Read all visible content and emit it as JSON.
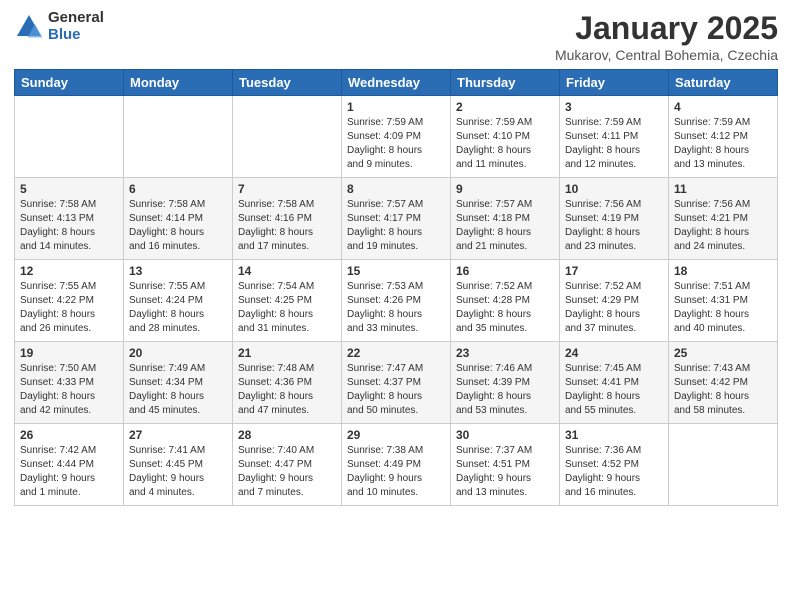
{
  "logo": {
    "general": "General",
    "blue": "Blue"
  },
  "title": "January 2025",
  "location": "Mukarov, Central Bohemia, Czechia",
  "days_of_week": [
    "Sunday",
    "Monday",
    "Tuesday",
    "Wednesday",
    "Thursday",
    "Friday",
    "Saturday"
  ],
  "weeks": [
    [
      {
        "day": "",
        "detail": ""
      },
      {
        "day": "",
        "detail": ""
      },
      {
        "day": "",
        "detail": ""
      },
      {
        "day": "1",
        "detail": "Sunrise: 7:59 AM\nSunset: 4:09 PM\nDaylight: 8 hours\nand 9 minutes."
      },
      {
        "day": "2",
        "detail": "Sunrise: 7:59 AM\nSunset: 4:10 PM\nDaylight: 8 hours\nand 11 minutes."
      },
      {
        "day": "3",
        "detail": "Sunrise: 7:59 AM\nSunset: 4:11 PM\nDaylight: 8 hours\nand 12 minutes."
      },
      {
        "day": "4",
        "detail": "Sunrise: 7:59 AM\nSunset: 4:12 PM\nDaylight: 8 hours\nand 13 minutes."
      }
    ],
    [
      {
        "day": "5",
        "detail": "Sunrise: 7:58 AM\nSunset: 4:13 PM\nDaylight: 8 hours\nand 14 minutes."
      },
      {
        "day": "6",
        "detail": "Sunrise: 7:58 AM\nSunset: 4:14 PM\nDaylight: 8 hours\nand 16 minutes."
      },
      {
        "day": "7",
        "detail": "Sunrise: 7:58 AM\nSunset: 4:16 PM\nDaylight: 8 hours\nand 17 minutes."
      },
      {
        "day": "8",
        "detail": "Sunrise: 7:57 AM\nSunset: 4:17 PM\nDaylight: 8 hours\nand 19 minutes."
      },
      {
        "day": "9",
        "detail": "Sunrise: 7:57 AM\nSunset: 4:18 PM\nDaylight: 8 hours\nand 21 minutes."
      },
      {
        "day": "10",
        "detail": "Sunrise: 7:56 AM\nSunset: 4:19 PM\nDaylight: 8 hours\nand 23 minutes."
      },
      {
        "day": "11",
        "detail": "Sunrise: 7:56 AM\nSunset: 4:21 PM\nDaylight: 8 hours\nand 24 minutes."
      }
    ],
    [
      {
        "day": "12",
        "detail": "Sunrise: 7:55 AM\nSunset: 4:22 PM\nDaylight: 8 hours\nand 26 minutes."
      },
      {
        "day": "13",
        "detail": "Sunrise: 7:55 AM\nSunset: 4:24 PM\nDaylight: 8 hours\nand 28 minutes."
      },
      {
        "day": "14",
        "detail": "Sunrise: 7:54 AM\nSunset: 4:25 PM\nDaylight: 8 hours\nand 31 minutes."
      },
      {
        "day": "15",
        "detail": "Sunrise: 7:53 AM\nSunset: 4:26 PM\nDaylight: 8 hours\nand 33 minutes."
      },
      {
        "day": "16",
        "detail": "Sunrise: 7:52 AM\nSunset: 4:28 PM\nDaylight: 8 hours\nand 35 minutes."
      },
      {
        "day": "17",
        "detail": "Sunrise: 7:52 AM\nSunset: 4:29 PM\nDaylight: 8 hours\nand 37 minutes."
      },
      {
        "day": "18",
        "detail": "Sunrise: 7:51 AM\nSunset: 4:31 PM\nDaylight: 8 hours\nand 40 minutes."
      }
    ],
    [
      {
        "day": "19",
        "detail": "Sunrise: 7:50 AM\nSunset: 4:33 PM\nDaylight: 8 hours\nand 42 minutes."
      },
      {
        "day": "20",
        "detail": "Sunrise: 7:49 AM\nSunset: 4:34 PM\nDaylight: 8 hours\nand 45 minutes."
      },
      {
        "day": "21",
        "detail": "Sunrise: 7:48 AM\nSunset: 4:36 PM\nDaylight: 8 hours\nand 47 minutes."
      },
      {
        "day": "22",
        "detail": "Sunrise: 7:47 AM\nSunset: 4:37 PM\nDaylight: 8 hours\nand 50 minutes."
      },
      {
        "day": "23",
        "detail": "Sunrise: 7:46 AM\nSunset: 4:39 PM\nDaylight: 8 hours\nand 53 minutes."
      },
      {
        "day": "24",
        "detail": "Sunrise: 7:45 AM\nSunset: 4:41 PM\nDaylight: 8 hours\nand 55 minutes."
      },
      {
        "day": "25",
        "detail": "Sunrise: 7:43 AM\nSunset: 4:42 PM\nDaylight: 8 hours\nand 58 minutes."
      }
    ],
    [
      {
        "day": "26",
        "detail": "Sunrise: 7:42 AM\nSunset: 4:44 PM\nDaylight: 9 hours\nand 1 minute."
      },
      {
        "day": "27",
        "detail": "Sunrise: 7:41 AM\nSunset: 4:45 PM\nDaylight: 9 hours\nand 4 minutes."
      },
      {
        "day": "28",
        "detail": "Sunrise: 7:40 AM\nSunset: 4:47 PM\nDaylight: 9 hours\nand 7 minutes."
      },
      {
        "day": "29",
        "detail": "Sunrise: 7:38 AM\nSunset: 4:49 PM\nDaylight: 9 hours\nand 10 minutes."
      },
      {
        "day": "30",
        "detail": "Sunrise: 7:37 AM\nSunset: 4:51 PM\nDaylight: 9 hours\nand 13 minutes."
      },
      {
        "day": "31",
        "detail": "Sunrise: 7:36 AM\nSunset: 4:52 PM\nDaylight: 9 hours\nand 16 minutes."
      },
      {
        "day": "",
        "detail": ""
      }
    ]
  ]
}
